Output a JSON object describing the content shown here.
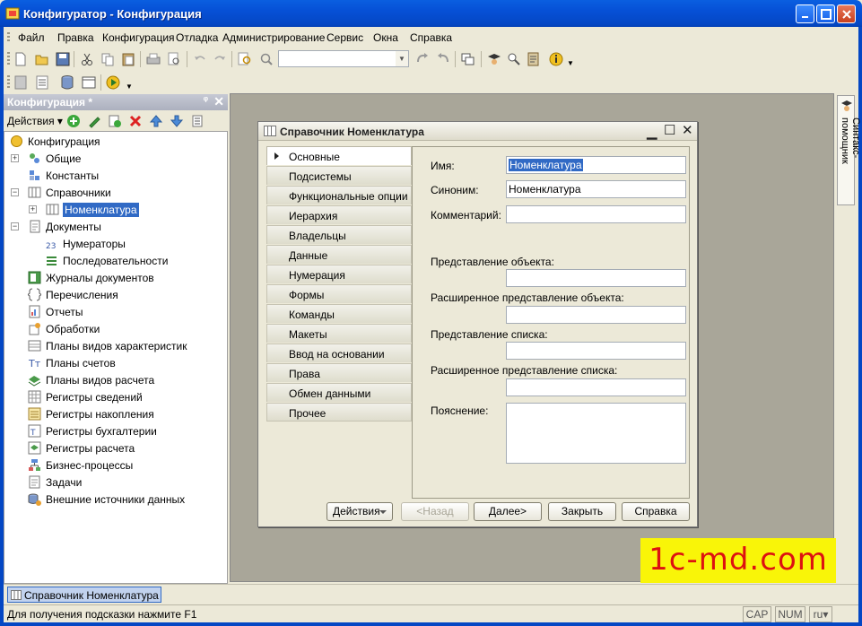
{
  "window": {
    "title": "Конфигуратор - Конфигурация"
  },
  "menu": [
    "Файл",
    "Правка",
    "Конфигурация",
    "Отладка",
    "Администрирование",
    "Сервис",
    "Окна",
    "Справка"
  ],
  "left_panel": {
    "title": "Конфигурация *",
    "actions_label": "Действия",
    "tree": [
      {
        "label": "Конфигурация",
        "icon": "config-root-icon"
      },
      {
        "label": "Общие",
        "icon": "common-icon"
      },
      {
        "label": "Константы",
        "icon": "constants-icon"
      },
      {
        "label": "Справочники",
        "icon": "catalogs-icon"
      },
      {
        "label": "Номенклатура",
        "icon": "catalog-item-icon"
      },
      {
        "label": "Документы",
        "icon": "documents-icon"
      },
      {
        "label": "Нумераторы",
        "icon": "numerators-icon"
      },
      {
        "label": "Последовательности",
        "icon": "sequences-icon"
      },
      {
        "label": "Журналы документов",
        "icon": "journals-icon"
      },
      {
        "label": "Перечисления",
        "icon": "enums-icon"
      },
      {
        "label": "Отчеты",
        "icon": "reports-icon"
      },
      {
        "label": "Обработки",
        "icon": "dataprocessors-icon"
      },
      {
        "label": "Планы видов характеристик",
        "icon": "chartofcharacteristics-icon"
      },
      {
        "label": "Планы счетов",
        "icon": "chartofaccounts-icon"
      },
      {
        "label": "Планы видов расчета",
        "icon": "chartofcalculation-icon"
      },
      {
        "label": "Регистры сведений",
        "icon": "info-registers-icon"
      },
      {
        "label": "Регистры накопления",
        "icon": "accum-registers-icon"
      },
      {
        "label": "Регистры бухгалтерии",
        "icon": "acc-registers-icon"
      },
      {
        "label": "Регистры расчета",
        "icon": "calc-registers-icon"
      },
      {
        "label": "Бизнес-процессы",
        "icon": "business-processes-icon"
      },
      {
        "label": "Задачи",
        "icon": "tasks-icon"
      },
      {
        "label": "Внешние источники данных",
        "icon": "external-sources-icon"
      }
    ]
  },
  "syntax_helper": {
    "label": "Синтакс-помощник"
  },
  "dialog": {
    "title": "Справочник Номенклатура",
    "nav": [
      "Основные",
      "Подсистемы",
      "Функциональные опции",
      "Иерархия",
      "Владельцы",
      "Данные",
      "Нумерация",
      "Формы",
      "Команды",
      "Макеты",
      "Ввод на основании",
      "Права",
      "Обмен данными",
      "Прочее"
    ],
    "fields": {
      "name_label": "Имя:",
      "name_value": "Номенклатура",
      "synonym_label": "Синоним:",
      "synonym_value": "Номенклатура",
      "comment_label": "Комментарий:",
      "comment_value": "",
      "obj_repr_label": "Представление объекта:",
      "ext_obj_repr_label": "Расширенное представление объекта:",
      "list_repr_label": "Представление списка:",
      "ext_list_repr_label": "Расширенное представление списка:",
      "explanation_label": "Пояснение:"
    },
    "buttons": {
      "actions": "Действия",
      "back": "<Назад",
      "next": "Далее>",
      "close": "Закрыть",
      "help": "Справка"
    }
  },
  "watermark": "1c-md.com",
  "taskbar": {
    "window_tab": "Справочник Номенклатура"
  },
  "status": {
    "hint": "Для получения подсказки нажмите F1",
    "cap": "CAP",
    "num": "NUM",
    "lang": "ru"
  },
  "colors": {
    "title_bar": "#0447C4",
    "selection": "#316AC5",
    "workspace": "#A9A699",
    "watermark_bg": "#F9F508",
    "watermark_text": "#DD1111"
  }
}
